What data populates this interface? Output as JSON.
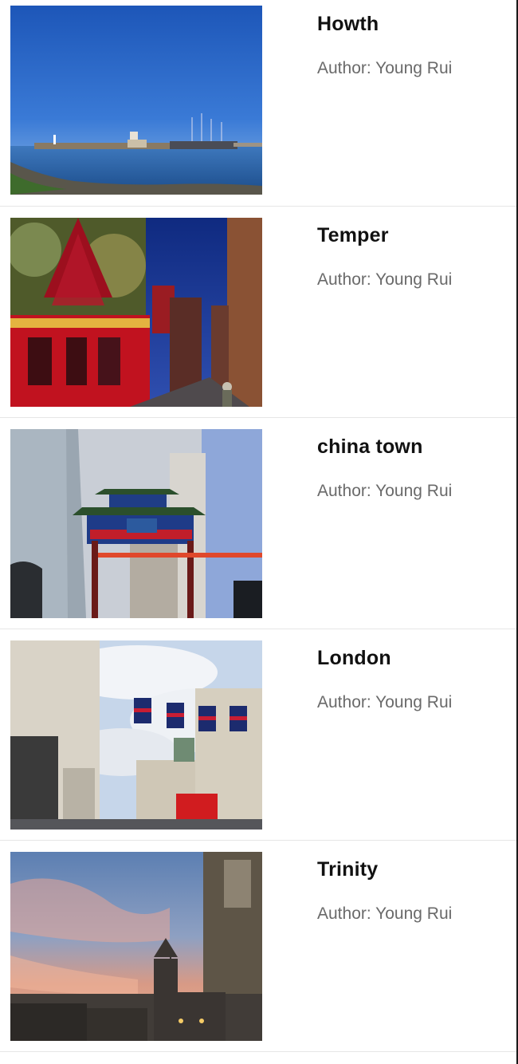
{
  "posts": [
    {
      "title": "Howth",
      "author": "Author: Young Rui",
      "image": "lighthouse-harbor-photo"
    },
    {
      "title": "Temper",
      "author": "Author: Young Rui",
      "image": "temple-bar-pub-night-photo"
    },
    {
      "title": "china town",
      "author": "Author: Young Rui",
      "image": "chinatown-gate-photo"
    },
    {
      "title": "London",
      "author": "Author: Young Rui",
      "image": "regent-street-flags-photo"
    },
    {
      "title": "Trinity",
      "author": "Author: Young Rui",
      "image": "trinity-college-sunset-photo"
    }
  ],
  "colors": {
    "title": "#111111",
    "author": "#6a6a6a",
    "divider": "#e6e6e6"
  }
}
